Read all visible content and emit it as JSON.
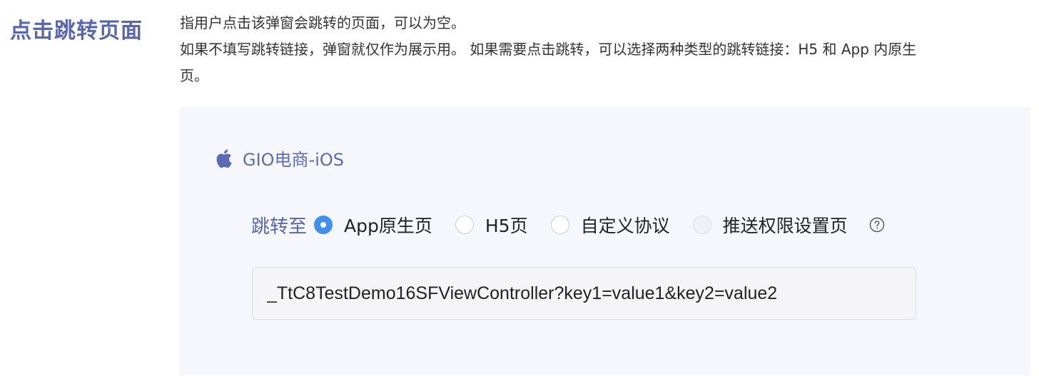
{
  "section": {
    "title": "点击跳转页面"
  },
  "description": {
    "line1": "指用户点击该弹窗会跳转的页面，可以为空。",
    "line2": "如果不填写跳转链接，弹窗就仅作为展示用。 如果需要点击跳转，可以选择两种类型的跳转链接：H5 和 App 内原生",
    "line3": "页。"
  },
  "app": {
    "icon": "apple-icon",
    "name": "GIO电商-iOS"
  },
  "jump": {
    "label": "跳转至",
    "options": [
      {
        "label": "App原生页",
        "checked": true,
        "disabled": false
      },
      {
        "label": "H5页",
        "checked": false,
        "disabled": false
      },
      {
        "label": "自定义协议",
        "checked": false,
        "disabled": false
      },
      {
        "label": "推送权限设置页",
        "checked": false,
        "disabled": true
      }
    ],
    "help_icon": "question-circle-icon"
  },
  "link_input": {
    "value": "_TtC8TestDemo16SFViewController?key1=value1&key2=value2",
    "placeholder": ""
  },
  "colors": {
    "title": "#5866b0",
    "accent": "#3f8ef0",
    "panel_bg": "#f6f7fc"
  }
}
